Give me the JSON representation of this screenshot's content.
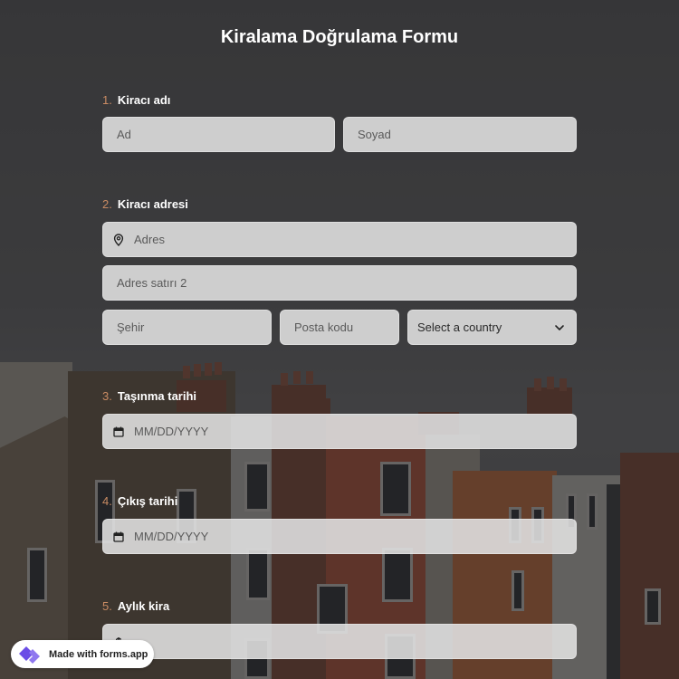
{
  "form": {
    "title": "Kiralama Doğrulama Formu",
    "questions": [
      {
        "number": "1.",
        "label": "Kiracı adı"
      },
      {
        "number": "2.",
        "label": "Kiracı adresi"
      },
      {
        "number": "3.",
        "label": "Taşınma tarihi"
      },
      {
        "number": "4.",
        "label": "Çıkış tarihi"
      },
      {
        "number": "5.",
        "label": "Aylık kira"
      }
    ],
    "fields": {
      "first_name_placeholder": "Ad",
      "last_name_placeholder": "Soyad",
      "address_placeholder": "Adres",
      "address2_placeholder": "Adres satırı 2",
      "city_placeholder": "Şehir",
      "postal_placeholder": "Posta kodu",
      "country_selected": "Select a country",
      "move_in_placeholder": "MM/DD/YYYY",
      "move_out_placeholder": "MM/DD/YYYY"
    }
  },
  "badge": {
    "text": "Made with forms.app"
  },
  "colors": {
    "accent_number": "#c98b63",
    "field_bg": "#e2e2e2",
    "title": "#ffffff",
    "badge_logo": "#6b4de6"
  },
  "icons": {
    "address": "location-pin-icon",
    "date": "calendar-icon",
    "select": "chevron-down-icon",
    "currency": "currency-icon",
    "logo": "forms-app-logo-icon"
  }
}
